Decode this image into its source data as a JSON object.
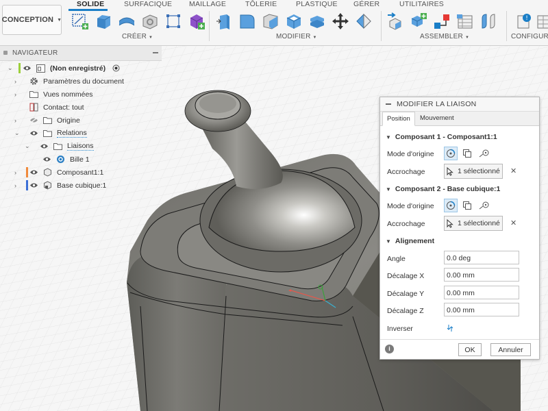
{
  "workspace": {
    "label": "CONCEPTION"
  },
  "tabs": [
    {
      "label": "SOLIDE",
      "active": true
    },
    {
      "label": "SURFACIQUE",
      "active": false
    },
    {
      "label": "MAILLAGE",
      "active": false
    },
    {
      "label": "TÔLERIE",
      "active": false
    },
    {
      "label": "PLASTIQUE",
      "active": false
    },
    {
      "label": "GÉRER",
      "active": false
    },
    {
      "label": "UTILITAIRES",
      "active": false
    }
  ],
  "groups": {
    "create": "CRÉER",
    "modify": "MODIFIER",
    "assemble": "ASSEMBLER",
    "configure": "CONFIGURER"
  },
  "navigator": {
    "title": "NAVIGATEUR",
    "items": [
      {
        "label": "(Non enregistré)"
      },
      {
        "label": "Paramètres du document"
      },
      {
        "label": "Vues nommées"
      },
      {
        "label": "Contact: tout"
      },
      {
        "label": "Origine"
      },
      {
        "label": "Relations"
      },
      {
        "label": "Liaisons"
      },
      {
        "label": "Bille 1"
      },
      {
        "label": "Composant1:1"
      },
      {
        "label": "Base cubique:1"
      }
    ]
  },
  "dialog": {
    "title": "MODIFIER LA LIAISON",
    "tab_position": "Position",
    "tab_motion": "Mouvement",
    "comp1_title": "Composant 1 - Composant1:1",
    "comp2_title": "Composant 2 - Base cubique:1",
    "origin_mode_label": "Mode d'origine",
    "snap_label": "Accrochage",
    "snap_value_1": "1 sélectionné",
    "snap_value_2": "1 sélectionné",
    "alignment_title": "Alignement",
    "angle_label": "Angle",
    "angle_value": "0.0 deg",
    "offset_x_label": "Décalage X",
    "offset_x_value": "0.00 mm",
    "offset_y_label": "Décalage Y",
    "offset_y_value": "0.00 mm",
    "offset_z_label": "Décalage Z",
    "offset_z_value": "0.00 mm",
    "invert_label": "Inverser",
    "ok_label": "OK",
    "cancel_label": "Annuler"
  },
  "colors": {
    "accent": "#1a7ec7",
    "component1_bar": "#f08a3c",
    "component2_bar": "#3c6fd6",
    "root_bar": "#9ccf3a",
    "model_metal": "#6b6b66"
  }
}
